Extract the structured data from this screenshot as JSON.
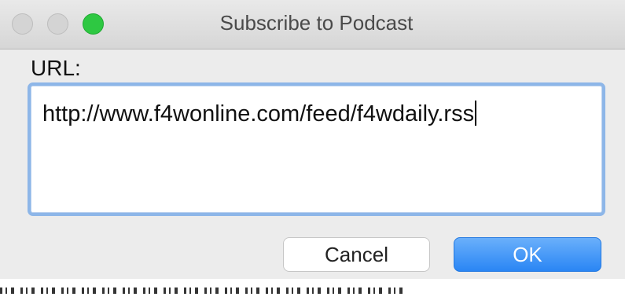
{
  "window": {
    "title": "Subscribe to Podcast"
  },
  "form": {
    "url_label": "URL:",
    "url_value": "http://www.f4wonline.com/feed/f4wdaily.rss"
  },
  "buttons": {
    "cancel_label": "Cancel",
    "ok_label": "OK"
  },
  "colors": {
    "ok_button": "#2a86f4",
    "focus_ring": "#8db6e8",
    "zoom_button": "#2ec842"
  },
  "icons": [
    "close-icon",
    "minimize-icon",
    "zoom-icon"
  ]
}
